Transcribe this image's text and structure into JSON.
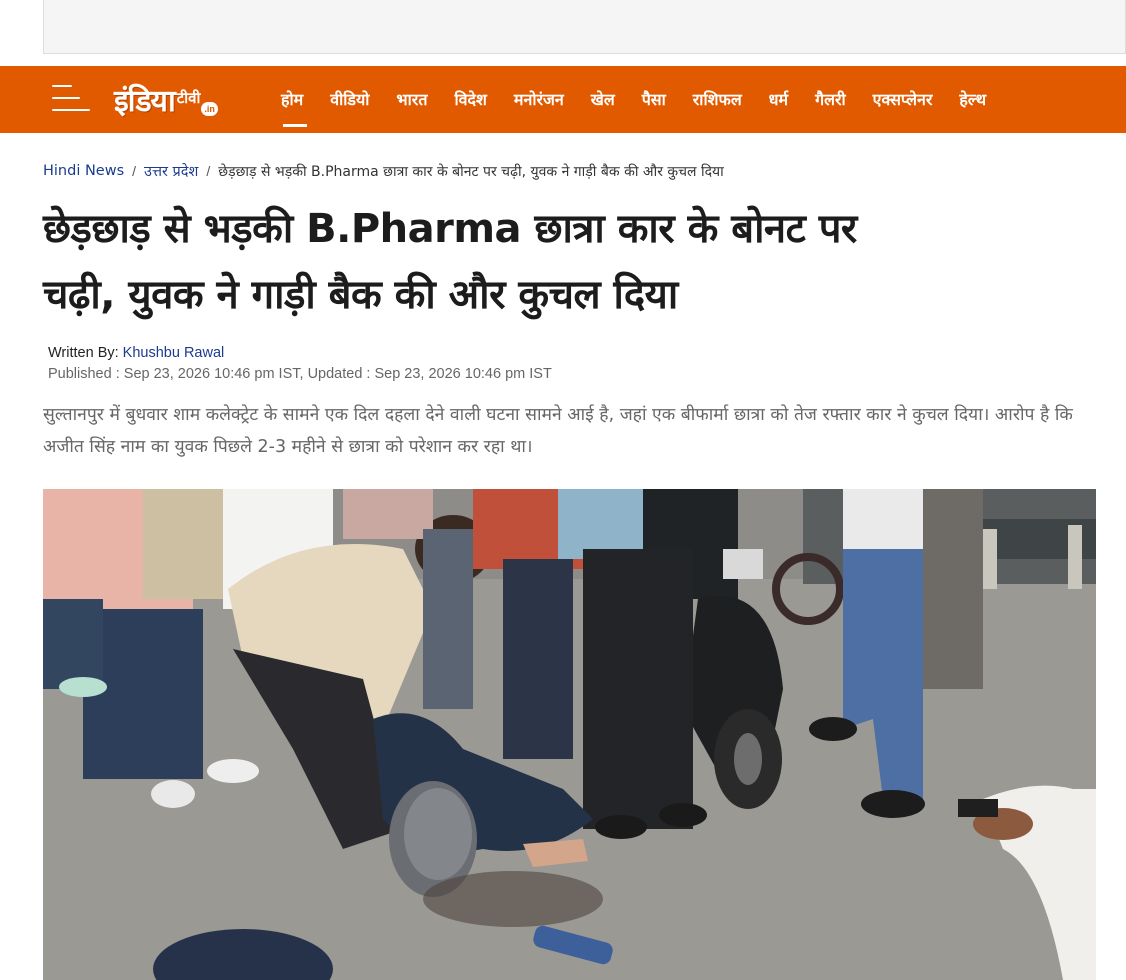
{
  "navbar": {
    "logo_main": "इंडिया",
    "logo_sub": "टीवी",
    "logo_in": ".in",
    "items": [
      {
        "label": "होम",
        "active": true
      },
      {
        "label": "वीडियो"
      },
      {
        "label": "भारत"
      },
      {
        "label": "विदेश"
      },
      {
        "label": "मनोरंजन"
      },
      {
        "label": "खेल"
      },
      {
        "label": "पैसा"
      },
      {
        "label": "राशिफल"
      },
      {
        "label": "धर्म"
      },
      {
        "label": "गैलरी"
      },
      {
        "label": "एक्सप्लेनर"
      },
      {
        "label": "हेल्थ"
      }
    ]
  },
  "breadcrumb": {
    "home": "Hindi News",
    "section": "उत्तर प्रदेश",
    "current": "छेड़छाड़ से भड़की B.Pharma छात्रा कार के बोनट पर चढ़ी, युवक ने गाड़ी बैक की और कुचल दिया"
  },
  "article": {
    "headline_line1": "छेड़छाड़ से भड़की B.Pharma छात्रा कार के बोनट पर",
    "headline_line2": "चढ़ी, युवक ने गाड़ी बैक की और कुचल दिया",
    "written_by_label": "Written By:",
    "author": "Khushbu Rawal",
    "published": "Published : Sep 23, 2026 10:46 pm IST,  Updated : Sep 23, 2026 10:46 pm IST",
    "summary": "सुल्तानपुर में बुधवार शाम कलेक्ट्रेट के सामने एक दिल दहला देने वाली घटना सामने आई है, जहां एक बीफार्मा छात्रा को तेज रफ्तार कार ने कुचल दिया। आरोप है कि अजीत सिंह नाम का युवक पिछले 2-3 महीने से छात्रा को परेशान कर रहा था।"
  },
  "colors": {
    "brand_orange": "#e15a00",
    "link_blue": "#1a3b8f"
  }
}
